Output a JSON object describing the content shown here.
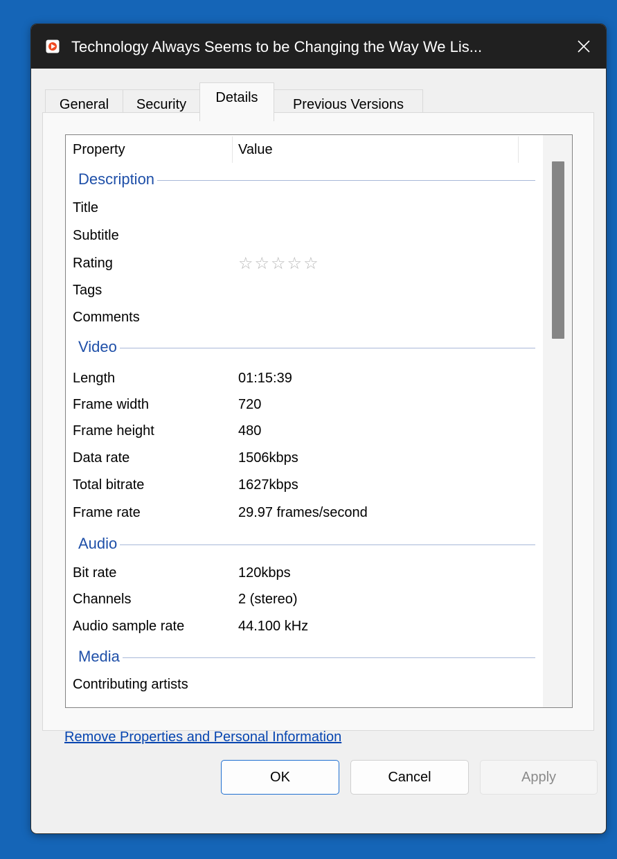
{
  "window": {
    "title": "Technology Always Seems to be Changing the Way We Lis...",
    "close_icon": "close-icon",
    "app_icon": "media-player-icon"
  },
  "tabs": [
    {
      "label": "General"
    },
    {
      "label": "Security"
    },
    {
      "label": "Details"
    },
    {
      "label": "Previous Versions"
    }
  ],
  "active_tab": "Details",
  "columns": {
    "property": "Property",
    "value": "Value"
  },
  "groups": {
    "description": {
      "label": "Description",
      "rows": [
        {
          "key": "Title",
          "value": ""
        },
        {
          "key": "Subtitle",
          "value": ""
        },
        {
          "key": "Rating",
          "value": "",
          "stars": 0,
          "stars_max": 5
        },
        {
          "key": "Tags",
          "value": ""
        },
        {
          "key": "Comments",
          "value": ""
        }
      ]
    },
    "video": {
      "label": "Video",
      "rows": [
        {
          "key": "Length",
          "value": "01:15:39"
        },
        {
          "key": "Frame width",
          "value": "720"
        },
        {
          "key": "Frame height",
          "value": "480"
        },
        {
          "key": "Data rate",
          "value": "1506kbps"
        },
        {
          "key": "Total bitrate",
          "value": "1627kbps"
        },
        {
          "key": "Frame rate",
          "value": "29.97 frames/second"
        }
      ]
    },
    "audio": {
      "label": "Audio",
      "rows": [
        {
          "key": "Bit rate",
          "value": "120kbps"
        },
        {
          "key": "Channels",
          "value": "2 (stereo)"
        },
        {
          "key": "Audio sample rate",
          "value": "44.100 kHz"
        }
      ]
    },
    "media": {
      "label": "Media",
      "rows": [
        {
          "key": "Contributing artists",
          "value": ""
        }
      ]
    }
  },
  "star_glyph": "☆",
  "remove_link": "Remove Properties and Personal Information",
  "buttons": {
    "ok": "OK",
    "cancel": "Cancel",
    "apply": "Apply"
  },
  "colors": {
    "desktop": "#1565b7",
    "titlebar": "#202020",
    "group_header": "#1e4fa8",
    "link": "#0645b0",
    "primary_border": "#1f6fd0"
  }
}
